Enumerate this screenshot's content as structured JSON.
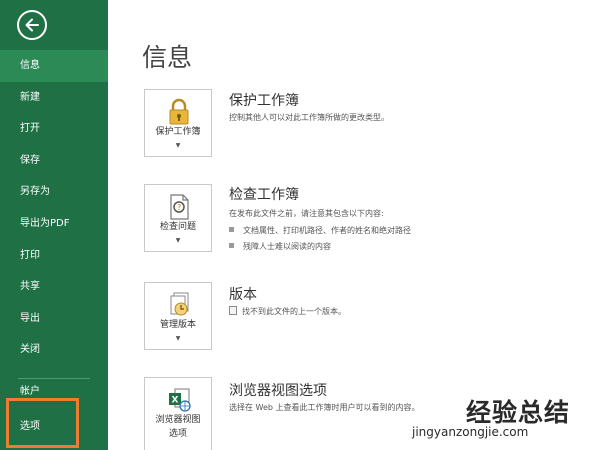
{
  "sidebar": {
    "items": [
      {
        "label": "信息",
        "active": true
      },
      {
        "label": "新建"
      },
      {
        "label": "打开"
      },
      {
        "label": "保存"
      },
      {
        "label": "另存为"
      },
      {
        "label": "导出为PDF"
      },
      {
        "label": "打印"
      },
      {
        "label": "共享"
      },
      {
        "label": "导出"
      },
      {
        "label": "关闭"
      }
    ],
    "account_label": "帐户",
    "options_label": "选项",
    "highlight_color": "#ee7d31",
    "background_color": "#1f7145"
  },
  "main": {
    "title": "信息",
    "sections": {
      "protect": {
        "tile_label": "保护工作簿",
        "title": "保护工作簿",
        "description": "控制其他人可以对此工作簿所做的更改类型。"
      },
      "inspect": {
        "tile_label": "检查问题",
        "title": "检查工作簿",
        "description": "在发布此文件之前，请注意其包含以下内容:",
        "bullets": [
          "文档属性、打印机路径、作者的姓名和绝对路径",
          "残障人士难以阅读的内容"
        ]
      },
      "versions": {
        "tile_label": "管理版本",
        "title": "版本",
        "description": "找不到此文件的上一个版本。"
      },
      "browser": {
        "tile_label_line1": "浏览器视图",
        "tile_label_line2": "选项",
        "title": "浏览器视图选项",
        "description": "选择在 Web 上查看此工作簿时用户可以看到的内容。"
      }
    }
  },
  "watermark": {
    "text_cn": "经验总结",
    "url": "jingyanzongjie.com"
  }
}
